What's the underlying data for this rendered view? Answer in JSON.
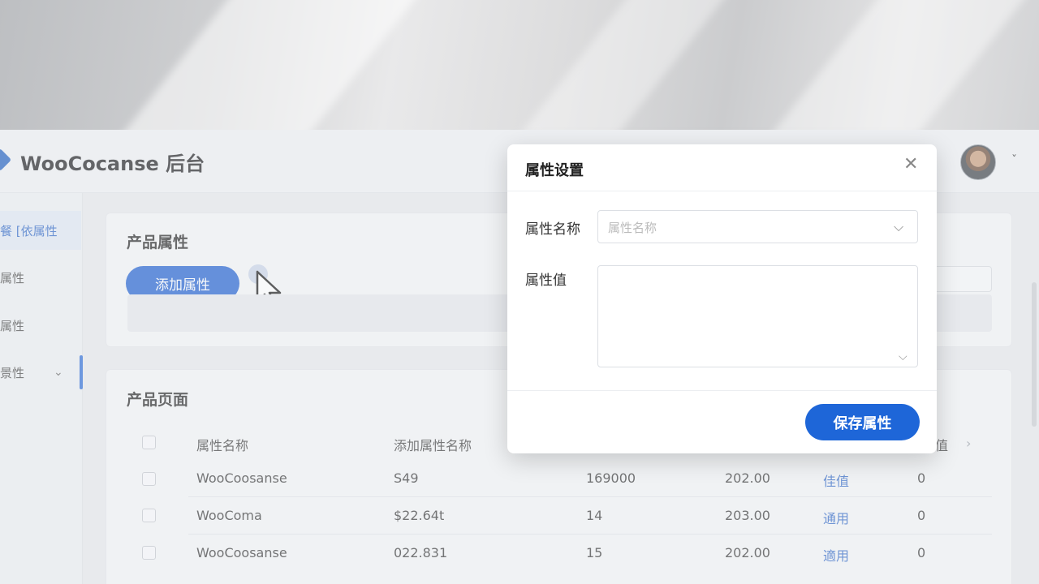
{
  "app": {
    "title": "WooCocanse 后台"
  },
  "sidebar": {
    "items": [
      {
        "label": "餐 [依属性",
        "active": true
      },
      {
        "label": "属性"
      },
      {
        "label": "属性"
      },
      {
        "label": "景性",
        "expandable": true
      }
    ]
  },
  "attributes_card": {
    "title": "产品属性",
    "add_button": "添加属性"
  },
  "product_page_card": {
    "title": "产品页面",
    "table": {
      "columns": [
        "属性名称",
        "添加属性名称",
        "",
        "",
        "",
        "值"
      ],
      "rows": [
        {
          "name": "WooCoosanse",
          "code": "S49",
          "qty": "169000",
          "price": "202.00",
          "status": "佳值",
          "count": "0"
        },
        {
          "name": "WooComa",
          "code": "$22.64t",
          "qty": "14",
          "price": "203.00",
          "status": "通用",
          "count": "0"
        },
        {
          "name": "WooCoosanse",
          "code": "022.831",
          "qty": "15",
          "price": "202.00",
          "status": "適用",
          "count": "0"
        }
      ]
    }
  },
  "modal": {
    "title": "属性设置",
    "name_label": "属性名称",
    "name_placeholder": "属性名称",
    "value_label": "属性值",
    "save_button": "保存属性"
  },
  "colors": {
    "primary": "#1e5fcf",
    "link": "#2b64c5"
  }
}
